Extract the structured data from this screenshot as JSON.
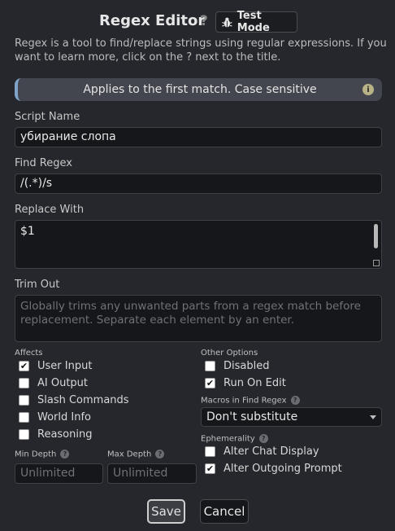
{
  "header": {
    "title": "Regex Editor",
    "help": "?",
    "test_mode": "Test Mode"
  },
  "description": "Regex is a tool to find/replace strings using regular expressions. If you want to learn more, click on the ? next to the title.",
  "banner": {
    "text": "Applies to the first match. Case sensitive",
    "icon": "i"
  },
  "script_name": {
    "label": "Script Name",
    "value": "убирание слопа"
  },
  "find_regex": {
    "label": "Find Regex",
    "value": "/(.*)/s"
  },
  "replace_with": {
    "label": "Replace With",
    "value": "$1"
  },
  "trim_out": {
    "label": "Trim Out",
    "placeholder": "Globally trims any unwanted parts from a regex match before replacement. Separate each element by an enter."
  },
  "affects": {
    "label": "Affects",
    "items": [
      {
        "label": "User Input",
        "checked": true
      },
      {
        "label": "AI Output",
        "checked": false
      },
      {
        "label": "Slash Commands",
        "checked": false
      },
      {
        "label": "World Info",
        "checked": false
      },
      {
        "label": "Reasoning",
        "checked": false
      }
    ]
  },
  "other_options": {
    "label": "Other Options",
    "items": [
      {
        "label": "Disabled",
        "checked": false
      },
      {
        "label": "Run On Edit",
        "checked": true
      }
    ]
  },
  "macros": {
    "label": "Macros in Find Regex",
    "value": "Don't substitute"
  },
  "ephemerality": {
    "label": "Ephemerality",
    "items": [
      {
        "label": "Alter Chat Display",
        "checked": false
      },
      {
        "label": "Alter Outgoing Prompt",
        "checked": true
      }
    ]
  },
  "min_depth": {
    "label": "Min Depth",
    "placeholder": "Unlimited"
  },
  "max_depth": {
    "label": "Max Depth",
    "placeholder": "Unlimited"
  },
  "buttons": {
    "save": "Save",
    "cancel": "Cancel"
  },
  "check_glyph": "✔",
  "colors": {
    "accent": "#7fa3c8",
    "background": "#25272d",
    "field": "#16171a"
  }
}
